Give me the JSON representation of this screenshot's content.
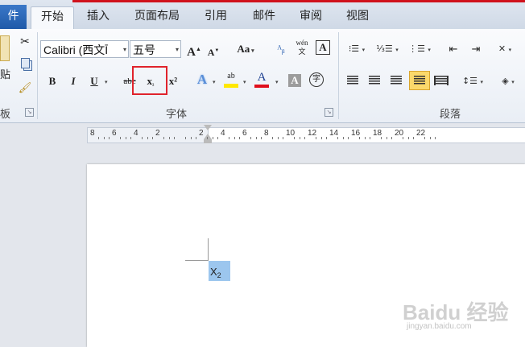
{
  "tabs": {
    "file": "件",
    "home": "开始",
    "insert": "插入",
    "layout": "页面布局",
    "references": "引用",
    "mailings": "邮件",
    "review": "审阅",
    "view": "视图"
  },
  "clipboard": {
    "paste_char": "贴",
    "group_label": "板"
  },
  "font": {
    "family_value": "Calibri (西文Ī",
    "size_value": "五号",
    "group_label": "字体",
    "bold": "B",
    "italic": "I",
    "underline": "U",
    "strike": "abc",
    "subscript_main": "x",
    "subscript_sub": "₂",
    "superscript": "x²",
    "grow": "A",
    "shrink": "A",
    "case": "Aa",
    "phonetic": "wén",
    "font_color_letter": "A",
    "highlight_letter": "ab"
  },
  "paragraph": {
    "group_label": "段落"
  },
  "ruler": {
    "labels": [
      "8",
      "6",
      "4",
      "2",
      "",
      "2",
      "4",
      "6",
      "8",
      "10",
      "12",
      "14",
      "16",
      "18",
      "20",
      "22"
    ]
  },
  "document": {
    "selected_text_main": "X",
    "selected_text_sub": "2"
  },
  "watermark": {
    "main": "Baidu 经验",
    "sub": "jingyan.baidu.com"
  },
  "colors": {
    "accent_red": "#e0232c",
    "highlight_yellow": "#ffe800",
    "font_red": "#e0101c",
    "selection": "#9cc6ee"
  }
}
